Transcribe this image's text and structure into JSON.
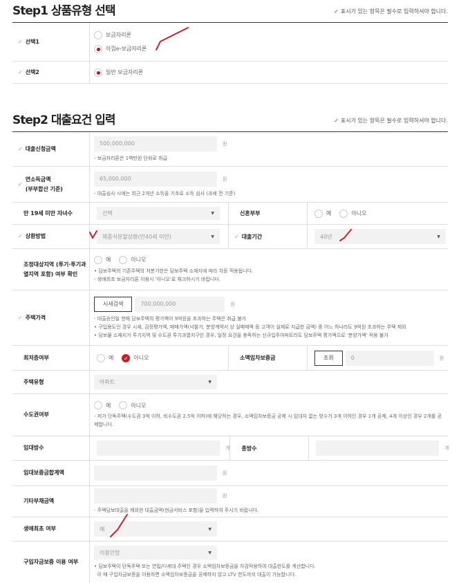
{
  "required_note": "표시가 있는 항목은 필수로 입력하셔야 합니다.",
  "step1": {
    "title": "Step1 상품유형 선택",
    "choice1": {
      "label": "선택1",
      "options": [
        "보금자리론",
        "아낌e-보금자리론"
      ],
      "selected": 1
    },
    "choice2": {
      "label": "선택2",
      "options": [
        "일반 보금자리론"
      ],
      "selected": 0
    }
  },
  "step2": {
    "title": "Step2 대출요건 입력",
    "loan_amount": {
      "label": "대출신청금액",
      "value": "500,000,000",
      "unit": "원",
      "note": "보금자리론은 1백만원 단위로 취급"
    },
    "income": {
      "label": "연소득금액",
      "label2": "(부부합산 기준)",
      "value": "65,000,000",
      "unit": "원",
      "note": "대출심사 시에는 최근 2개년 소득을 기초로 소득 심사 (과세 전 기준)"
    },
    "children": {
      "label": "만 19세 미만 자녀수",
      "value": "선택"
    },
    "newlywed": {
      "label": "신혼부부",
      "yes": "예",
      "no": "아니오"
    },
    "repayment": {
      "label": "상환방법",
      "value": "체증식분할상환(만40세 미만)"
    },
    "term": {
      "label": "대출기간",
      "value": "40년"
    },
    "regulated": {
      "label": "조정대상지역 (투기·투기과열지역 포함) 여부 확인",
      "yes": "예",
      "no": "아니오",
      "notes": [
        "담보주택의 기존주택의 처분기한은 담보주택 소재지에 따라 차등 적용됩니다.",
        "생애최초 보금자리론 이용시 '아니오'로 체크하시기 바랍니다."
      ]
    },
    "house_price": {
      "label": "주택가격",
      "button": "시세검색",
      "value": "700,000,000",
      "unit": "원",
      "notes": [
        "대출승인일 현재 담보주택의 평가액이 9억원을 초과하는 주택은 취급 불가",
        "구입용도인 경우 시세, 감정평가액, 매매가액(낙찰가, 분양계약서 상 실매매액 등 고객이 실제로 지급한 금액) 중 어느 하나라도 9억원 초과하는 주택 제외",
        "담보물 소재지가 투기지역 및 수도권 투기과열지구인 경우, 일정 요건을 충족하는 신규입주아파트라도 담보주택 평가액으로 '분양가액' 적용 불가"
      ]
    },
    "lowest_floor": {
      "label": "최저층여부",
      "yes": "예",
      "no": "아니오",
      "selected": "no"
    },
    "small_deposit": {
      "label": "소액임차보증금",
      "button": "조회",
      "value": "0",
      "unit": "원"
    },
    "house_type": {
      "label": "주택유형",
      "value": "아파트"
    },
    "capital_area": {
      "label": "수도권여부",
      "yes": "예",
      "no": "아니오",
      "note": "저가 단독주택(수도권 3억 이하, 비수도권 2.5억 이하)에 해당하는 경우, 소액임차보증금 공제 시 임대차 없는 방수가 3개 이하인 경우 1개 공제, 4개 이상인 경우 2개를 공제합니다."
    },
    "rent_rooms": {
      "label": "임대방수",
      "unit": "개"
    },
    "total_rooms": {
      "label": "총방수",
      "unit": "개"
    },
    "rent_deposit": {
      "label": "임대보증금합계액",
      "unit": "원"
    },
    "other_debt": {
      "label": "기타부채금액",
      "unit": "원",
      "note": "주택담보대출을 제외한 대출금액(현금서비스 포함)을 입력하여 주시기 바랍니다."
    },
    "first_home": {
      "label": "생애최초 여부",
      "value": "예"
    },
    "purchase_guarantee": {
      "label": "구입자금보증 이용 여부",
      "value": "이용안함",
      "notes": [
        "담보주택이 단독주택 또는 연립/다세대 주택인 경우 소액임차보증금을 차감적용하여 대출한도를 계산합니다.",
        "이 때 구입자금보증을 이용하면 소액임차보증금을 공제하지 않고 LTV 한도까지 대출이 가능합니다."
      ]
    }
  },
  "accent": "#c0282d"
}
